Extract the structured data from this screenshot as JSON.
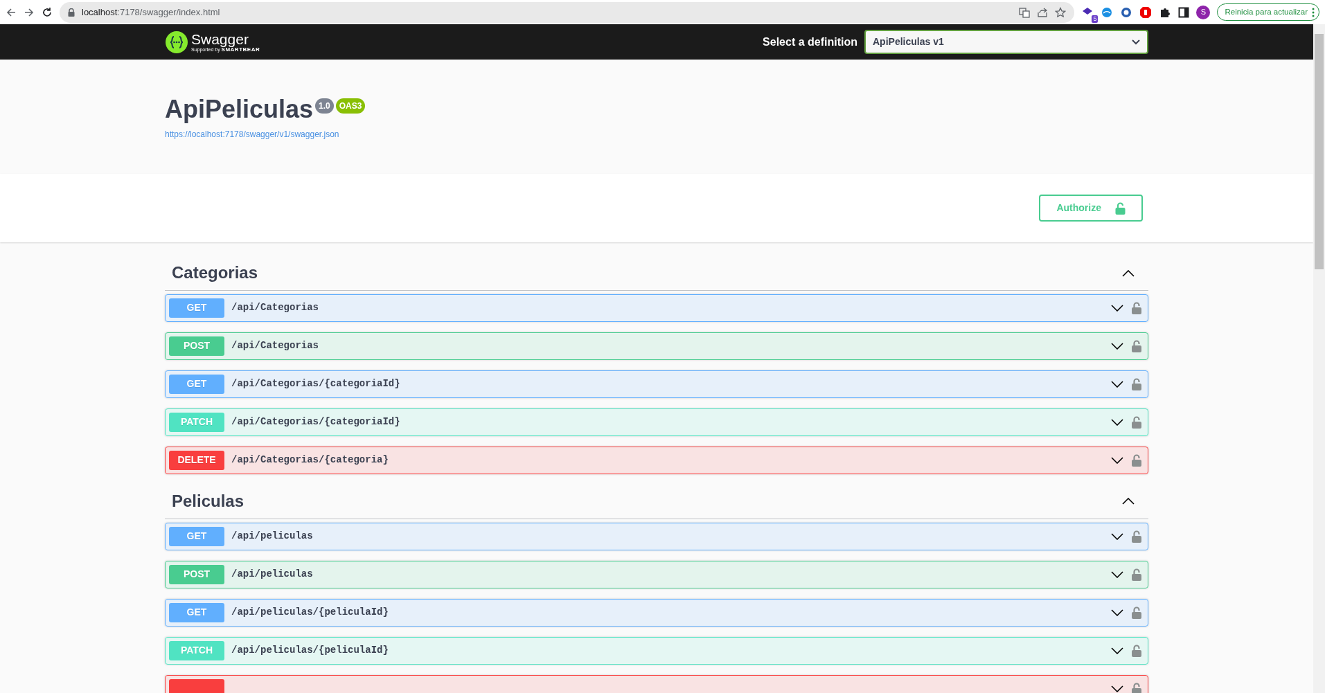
{
  "browser": {
    "url_host": "localhost",
    "url_rest": ":7178/swagger/index.html",
    "extension_badge": "5",
    "profile_initial": "S",
    "update_button": "Reinicia para actualizar"
  },
  "topbar": {
    "brand": "Swagger",
    "brand_sub_prefix": "Supported by",
    "brand_sub": "SMARTBEAR",
    "definition_label": "Select a definition",
    "definition_value": "ApiPeliculas v1"
  },
  "info": {
    "title": "ApiPeliculas",
    "version": "1.0",
    "oas": "OAS3",
    "spec_url": "https://localhost:7178/swagger/v1/swagger.json"
  },
  "authorize": {
    "label": "Authorize"
  },
  "tags": [
    {
      "name": "Categorias",
      "expanded": true,
      "operations": [
        {
          "kind": "get",
          "method": "GET",
          "path": "/api/Categorias",
          "expanded": false
        },
        {
          "kind": "post",
          "method": "POST",
          "path": "/api/Categorias",
          "expanded": false
        },
        {
          "kind": "get",
          "method": "GET",
          "path": "/api/Categorias/{categoriaId}",
          "expanded": false
        },
        {
          "kind": "patch",
          "method": "PATCH",
          "path": "/api/Categorias/{categoriaId}",
          "expanded": false
        },
        {
          "kind": "delete",
          "method": "DELETE",
          "path": "/api/Categorias/{categoria}",
          "expanded": false
        }
      ]
    },
    {
      "name": "Peliculas",
      "expanded": true,
      "operations": [
        {
          "kind": "get",
          "method": "GET",
          "path": "/api/peliculas",
          "expanded": false
        },
        {
          "kind": "post",
          "method": "POST",
          "path": "/api/peliculas",
          "expanded": false
        },
        {
          "kind": "get",
          "method": "GET",
          "path": "/api/peliculas/{peliculaId}",
          "expanded": false
        },
        {
          "kind": "patch",
          "method": "PATCH",
          "path": "/api/peliculas/{peliculaId}",
          "expanded": false
        },
        {
          "kind": "delete",
          "expanded": false
        }
      ]
    }
  ]
}
